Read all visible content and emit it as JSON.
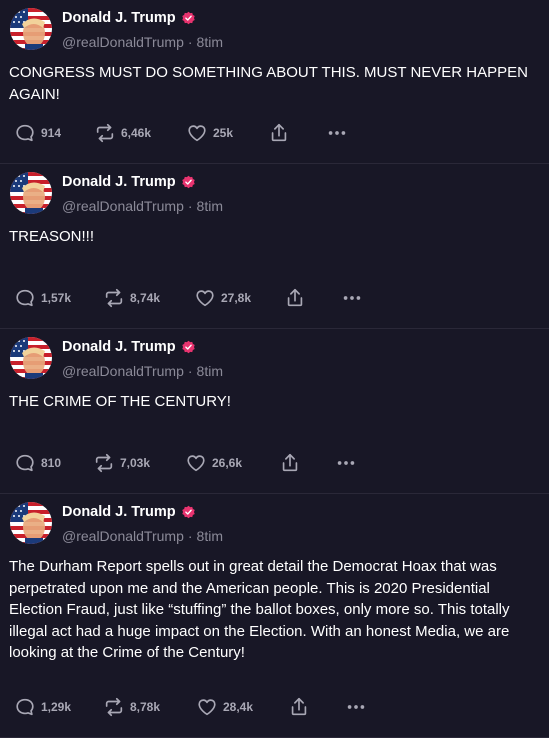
{
  "posts": [
    {
      "author": "Donald J. Trump",
      "handle": "@realDonaldTrump",
      "time": "8tim",
      "text": "CONGRESS MUST DO SOMETHING ABOUT THIS. MUST NEVER HAPPEN AGAIN!",
      "replies": "914",
      "reposts": "6,46k",
      "likes": "25k"
    },
    {
      "author": "Donald J. Trump",
      "handle": "@realDonaldTrump",
      "time": "8tim",
      "text": "TREASON!!!",
      "replies": "1,57k",
      "reposts": "8,74k",
      "likes": "27,8k"
    },
    {
      "author": "Donald J. Trump",
      "handle": "@realDonaldTrump",
      "time": "8tim",
      "text": "THE CRIME OF THE CENTURY!",
      "replies": "810",
      "reposts": "7,03k",
      "likes": "26,6k"
    },
    {
      "author": "Donald J. Trump",
      "handle": "@realDonaldTrump",
      "time": "8tim",
      "text": "The Durham Report spells out in great detail the Democrat Hoax that was perpetrated upon me and the American people. This is 2020 Presidential Election Fraud, ​just like “stuffing” the ballot boxes, only more so. This totally illegal act had a huge impact on the Election. With an honest Media, we are looking at the Crime of the Century!",
      "replies": "1,29k",
      "reposts": "8,78k",
      "likes": "28,4k"
    }
  ],
  "icons": {
    "verified": "verified-badge-icon",
    "reply": "reply-bubble-icon",
    "repost": "repost-arrows-icon",
    "like": "heart-icon",
    "share": "share-upload-icon",
    "more": "more-dots-icon"
  },
  "colors": {
    "background": "#181726",
    "verified_badge": "#e8336f",
    "muted_text": "#8b8a98"
  }
}
